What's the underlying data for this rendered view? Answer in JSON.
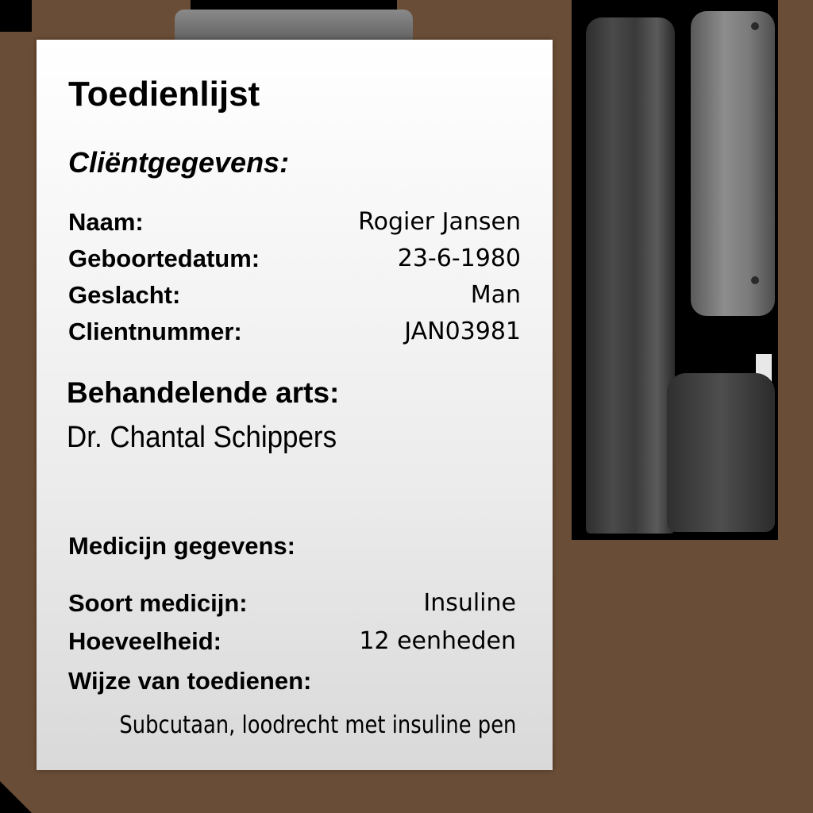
{
  "document": {
    "title": "Toedienlijst",
    "client_section": "Cliëntgegevens:",
    "client": [
      {
        "label": "Naam:",
        "value": "Rogier Jansen"
      },
      {
        "label": "Geboortedatum:",
        "value": "23-6-1980"
      },
      {
        "label": "Geslacht:",
        "value": "Man"
      },
      {
        "label": "Clientnummer:",
        "value": "JAN03981"
      }
    ],
    "physician_heading": "Behandelende arts:",
    "physician_name": "Dr. Chantal Schippers",
    "medicine_heading": "Medicijn gegevens:",
    "medicine": [
      {
        "label": "Soort medicijn:",
        "value": "Insuline"
      },
      {
        "label": "Hoeveelheid:",
        "value": "12 eenheden"
      }
    ],
    "route_label": "Wijze van toedienen:",
    "route_value": "Subcutaan, loodrecht met insuline pen"
  },
  "colors": {
    "board": "#6a4d36",
    "paper": "#ffffff",
    "text": "#000000"
  },
  "icons": {
    "pen": "insulin-pen-icon",
    "clip": "clipboard-clip-icon"
  }
}
